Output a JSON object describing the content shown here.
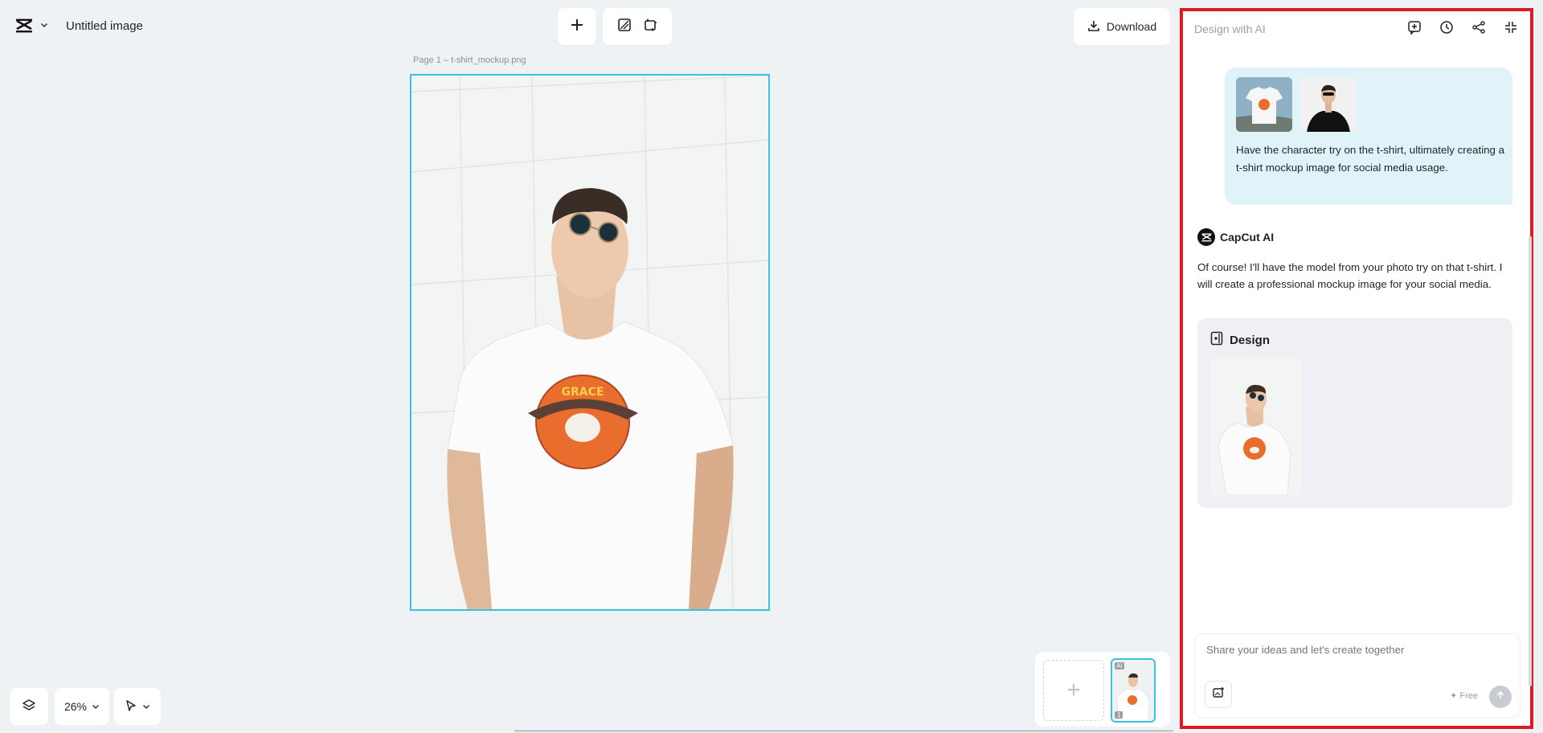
{
  "app": {
    "document_title": "Untitled image",
    "logo_icon": "capcut-logo-icon"
  },
  "toolbar": {
    "add_icon": "plus-icon",
    "tool_icons": [
      "image-edit-icon",
      "crop-resize-icon"
    ],
    "download_label": "Download"
  },
  "canvas": {
    "page_label": "Page 1 –  t-shirt_mockup.png"
  },
  "bottom_controls": {
    "zoom_value": "26%"
  },
  "pages": {
    "thumb_ai_badge": "AI",
    "thumb_number": "1"
  },
  "panel": {
    "title": "Design with AI",
    "icons": [
      "new-chat-icon",
      "history-icon",
      "share-icon",
      "collapse-icon"
    ],
    "user_message": "Have the character try on the t-shirt, ultimately creating a t-shirt mockup image for social media usage.",
    "assistant_name": "CapCut AI",
    "assistant_message": "Of course! I'll have the model from your photo try on that t-shirt. I will create a professional mockup image for your social media.",
    "design_card_title": "Design",
    "composer_placeholder": "Share your ideas and let's create together",
    "free_label": "Free"
  },
  "colors": {
    "selection": "#39c2e0",
    "highlight": "#e01a24",
    "user_bubble": "#dff3f8"
  }
}
